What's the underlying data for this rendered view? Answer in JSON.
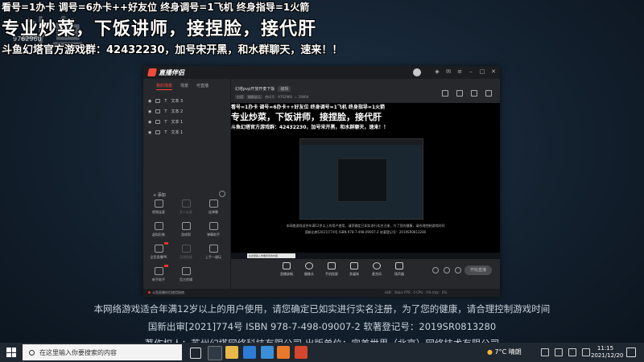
{
  "overlay": {
    "line1": "看号=1办卡 调号=6办卡++好友位 终身调号=1飞机 终身指导=1火箭",
    "line2": "专业炒菜，下饭讲师，接捏脸，接代肝",
    "line3": "斗鱼幻塔官方游戏群：42432230，加号宋开黑，和水群聊天，速来！！",
    "watermark": "斗鱼",
    "watermark_id": "9762960"
  },
  "app": {
    "name": "直播伴侣",
    "left_tabs": [
      "我的场景",
      "场景",
      "可直播"
    ],
    "sources": [
      "文本 3",
      "文本 2",
      "文本 1",
      "文本 1"
    ],
    "add_label": "+ 添加",
    "tools": [
      {
        "label": "视频连麦",
        "dim": false
      },
      {
        "label": "多人连麦",
        "dim": true
      },
      {
        "label": "连弹幕",
        "dim": false
      },
      {
        "label": "虚拟形象",
        "dim": false
      },
      {
        "label": "游戏帮",
        "dim": false
      },
      {
        "label": "弹幕助手",
        "dim": false
      },
      {
        "label": "全民直播PK",
        "dim": false
      },
      {
        "label": "无线投屏",
        "dim": true
      },
      {
        "label": "上手一键玩",
        "dim": false
      },
      {
        "label": "新手助手",
        "dim": false
      },
      {
        "label": "官方剪辑",
        "dim": false
      }
    ],
    "stream_title": "幻塔pvp开放开麦下饭",
    "stream_tag": "编辑",
    "meta": {
      "tag1": "幻塔",
      "tag2": "摄影幼儿",
      "room_label": "房间号",
      "room_id": "9762960",
      "hot": "29464"
    },
    "controls": [
      "直播录制",
      "摄像头",
      "手机投屏",
      "多媒体",
      "麦克风",
      "扬声器"
    ],
    "start_live": "开始直播",
    "status_left": "斗鱼直播伴侣使用指南",
    "status_right": "码率：0kb/s  FPS：0  CPU：0%  内存：0%"
  },
  "preview": {
    "notice1": "本网络游戏适合年满12岁以上的用户使用，请您确定已如实进行实名注册，为了您的健康，请合理控制游戏时间",
    "notice2": "国新出审[2021]774号  ISBN 978-7-498-09007-2  软著登记号：2019SR0813280",
    "search_placeholder": "在这里输入你要搜索的内容"
  },
  "desktop": {
    "notice1": "本网络游戏适合年满12岁以上的用户使用，请您确定已如实进行实名注册，为了您的健康，请合理控制游戏时间",
    "notice2": "国新出审[2021]774号  ISBN 978-7-498-09007-2  软著登记号：2019SR0813280",
    "notice3": "著作权人：苏州幻塔网络科技有限公司  出版单位：完美世界（北京）网络技术有限公司"
  },
  "taskbar": {
    "search_placeholder": "在这里输入你要搜索的内容",
    "weather": "7°C 晴朗",
    "time": "11:15",
    "date": "2021/12/20"
  },
  "colors": {
    "accent": "#f04a3a",
    "taskbar": "#1f2730"
  }
}
